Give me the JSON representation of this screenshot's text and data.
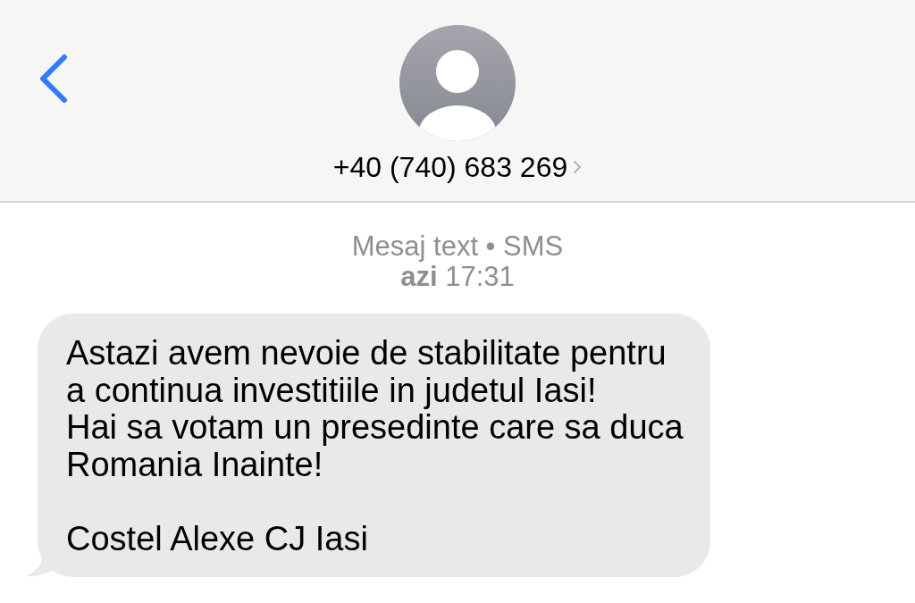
{
  "header": {
    "contact": "+40 (740) 683 269"
  },
  "thread": {
    "service": "Mesaj text • SMS",
    "timestamp": "**azi** 17:31"
  },
  "messages": [
    {
      "text": "Astazi avem nevoie de stabilitate pentru a continua investitiile in judetul Iasi!\nHai sa votam un presedinte care sa duca Romania Inainte!\n\nCostel Alexe CJ Iasi"
    }
  ]
}
